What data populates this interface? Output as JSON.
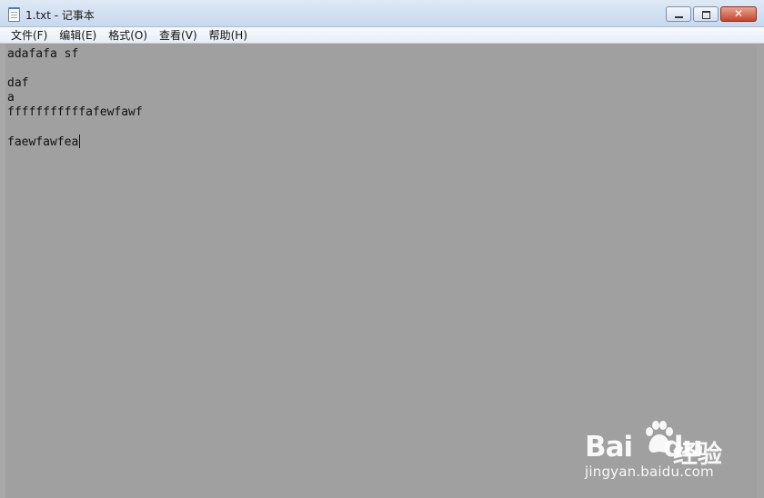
{
  "window": {
    "title": "1.txt - 记事本",
    "minimize_icon": "minimize-icon",
    "maximize_icon": "maximize-icon",
    "close_icon": "close-icon",
    "close_glyph": "✕"
  },
  "menu": {
    "items": [
      {
        "label": "文件(F)"
      },
      {
        "label": "编辑(E)"
      },
      {
        "label": "格式(O)"
      },
      {
        "label": "查看(V)"
      },
      {
        "label": "帮助(H)"
      }
    ]
  },
  "editor": {
    "lines": [
      "adafafa sf",
      "",
      "daf",
      "a",
      "fffffffffffafewfawf",
      "",
      "faewfawfea"
    ]
  },
  "watermark": {
    "logo_left": "Bai",
    "logo_right": "du",
    "brand": "经验",
    "url": "jingyan.baidu.com"
  }
}
